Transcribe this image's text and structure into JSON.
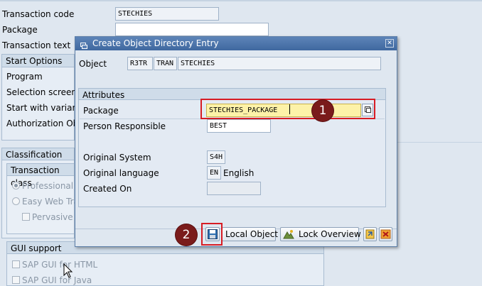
{
  "background": {
    "fields": {
      "transaction_code_label": "Transaction code",
      "transaction_code_value": "STECHIES",
      "package_label": "Package",
      "transaction_text_label": "Transaction text"
    },
    "start_options": {
      "title": "Start Options",
      "program": "Program",
      "selection_screen": "Selection screen",
      "start_with_variant": "Start with variant",
      "authorization_obj": "Authorization Obj"
    },
    "classification": {
      "title": "Classification",
      "transaction_class": "Transaction class",
      "professional": "Professional U",
      "easy_web": "Easy Web Tra",
      "pervasive": "Pervasive e"
    },
    "gui_support": {
      "title": "GUI support",
      "html": "SAP GUI for HTML",
      "java": "SAP GUI for Java"
    }
  },
  "dialog": {
    "title": "Create Object Directory Entry",
    "object_label": "Object",
    "object_values": [
      "R3TR",
      "TRAN",
      "STECHIES"
    ],
    "attributes_title": "Attributes",
    "package_label": "Package",
    "package_value": "STECHIES_PACKAGE",
    "person_responsible_label": "Person Responsible",
    "person_responsible_value": "BEST",
    "original_system_label": "Original System",
    "original_system_value": "S4H",
    "original_language_label": "Original language",
    "original_language_code": "EN",
    "original_language_name": "English",
    "created_on_label": "Created On",
    "created_on_value": "",
    "buttons": {
      "local_object": "Local Object",
      "lock_overview": "Lock Overview"
    }
  },
  "callouts": [
    "1",
    "2"
  ],
  "colors": {
    "highlight_border": "#d71c24",
    "callout_fill": "#7a1b1b",
    "titlebar": "#4a73aa",
    "package_field_bg": "#fdf2a8"
  }
}
